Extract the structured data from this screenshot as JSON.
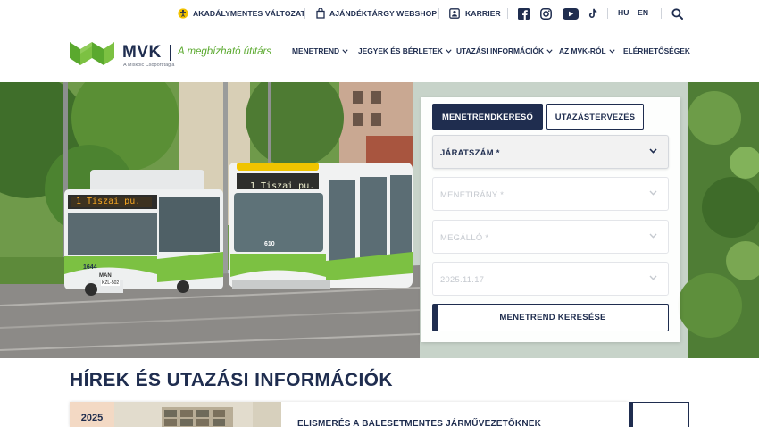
{
  "topbar": {
    "accessible": "AKADÁLYMENTES VÁLTOZAT",
    "webshop": "AJÁNDÉKTÁRGY WEBSHOP",
    "career": "KARRIER",
    "lang_hu": "HU",
    "lang_en": "EN",
    "icons": [
      "accessibility-icon",
      "bag-icon",
      "career-icon",
      "facebook-icon",
      "instagram-icon",
      "youtube-icon",
      "tiktok-icon",
      "search-icon"
    ]
  },
  "logo": {
    "name": "MVK",
    "slogan": "A megbízható útitárs",
    "group": "A Miskolc Csoport tagja"
  },
  "nav": {
    "items": [
      "MENETREND",
      "JEGYEK ÉS BÉRLETEK",
      "UTAZÁSI INFORMÁCIÓK",
      "AZ MVK-RÓL",
      "ELÉRHETŐSÉGEK"
    ]
  },
  "hero": {
    "bus_sign": "1  Tiszai pu.",
    "bus_number": "1644",
    "bus_brand": "MAN",
    "bus_plate": "KZL-502",
    "tram_sign": "1  Tiszai pu.",
    "tram_number": "610"
  },
  "planner": {
    "tab_active": "MENETRENDKERESŐ",
    "tab_inactive": "UTAZÁSTERVEZÉS",
    "route_number": "JÁRATSZÁM *",
    "direction": "MENETIRÁNY *",
    "stop": "MEGÁLLÓ *",
    "date": "2025.11.17",
    "search": "MENETREND KERESÉSE"
  },
  "news": {
    "title": "HÍREK ÉS UTAZÁSI INFORMÁCIÓK",
    "badge_year": "2025",
    "headline": "ELISMERÉS A BALESETMENTES JÁRMŰVEZETŐKNEK"
  },
  "colors": {
    "navy": "#1f2d4f",
    "green": "#5aa92e"
  }
}
